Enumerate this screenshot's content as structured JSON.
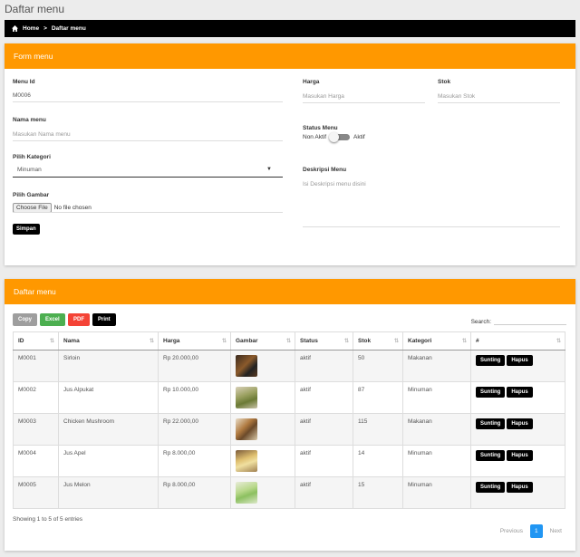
{
  "page_title": "Daftar menu",
  "breadcrumb": {
    "home": "Home",
    "separator": ">",
    "current": "Daftar menu"
  },
  "form": {
    "header": "Form menu",
    "menu_id": {
      "label": "Menu Id",
      "value": "M0006"
    },
    "nama_menu": {
      "label": "Nama menu",
      "placeholder": "Masukan Nama menu"
    },
    "kategori": {
      "label": "Pilih Kategori",
      "selected": "Minuman"
    },
    "gambar": {
      "label": "Pilih Gambar",
      "button": "Choose File",
      "status": "No file chosen"
    },
    "save_label": "Simpan",
    "harga": {
      "label": "Harga",
      "placeholder": "Masukan Harga"
    },
    "stok": {
      "label": "Stok",
      "placeholder": "Masukan Stok"
    },
    "status": {
      "label": "Status Menu",
      "off": "Non Aktif",
      "on": "Aktif",
      "checked": false
    },
    "deskripsi": {
      "label": "Deskripsi Menu",
      "placeholder": "Isi Deskripsi menu disini"
    }
  },
  "list": {
    "header": "Daftar menu",
    "buttons": {
      "copy": "Copy",
      "excel": "Excel",
      "pdf": "PDF",
      "print": "Print"
    },
    "search_label": "Search:",
    "columns": [
      "ID",
      "Nama",
      "Harga",
      "Gambar",
      "Status",
      "Stok",
      "Kategori",
      "#"
    ],
    "rows": [
      {
        "id": "M0001",
        "nama": "Sirloin",
        "harga": "Rp 20.000,00",
        "status": "aktif",
        "stok": "50",
        "kategori": "Makanan"
      },
      {
        "id": "M0002",
        "nama": "Jus Alpukat",
        "harga": "Rp 10.000,00",
        "status": "aktif",
        "stok": "87",
        "kategori": "Minuman"
      },
      {
        "id": "M0003",
        "nama": "Chicken Mushroom",
        "harga": "Rp 22.000,00",
        "status": "aktif",
        "stok": "115",
        "kategori": "Makanan"
      },
      {
        "id": "M0004",
        "nama": "Jus Apel",
        "harga": "Rp 8.000,00",
        "status": "aktif",
        "stok": "14",
        "kategori": "Minuman"
      },
      {
        "id": "M0005",
        "nama": "Jus Melon",
        "harga": "Rp 8.000,00",
        "status": "aktif",
        "stok": "15",
        "kategori": "Minuman"
      }
    ],
    "action_edit": "Sunting",
    "action_delete": "Hapus",
    "info": "Showing 1 to 5 of 5 entries",
    "pager": {
      "prev": "Previous",
      "current": "1",
      "next": "Next"
    }
  },
  "colors": {
    "accent": "#ff9800",
    "dark": "#000000",
    "copy": "#9e9e9e",
    "excel": "#4caf50",
    "pdf": "#f44336",
    "page": "#2196f3"
  }
}
